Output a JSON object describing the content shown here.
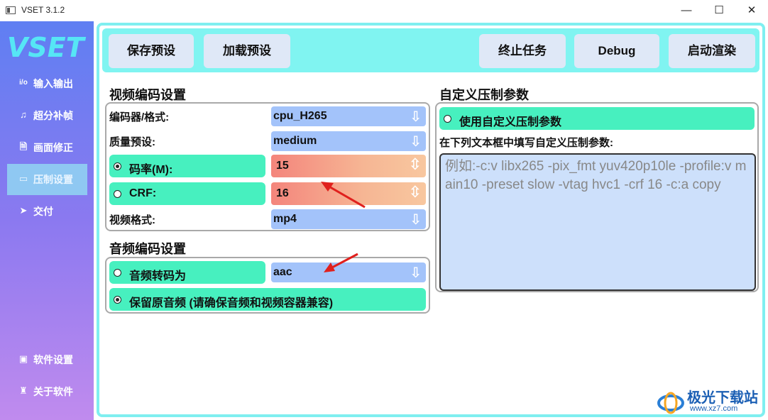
{
  "window": {
    "title": "VSET 3.1.2",
    "minimize_glyph": "—",
    "maximize_glyph": "☐",
    "close_glyph": "✕"
  },
  "sidebar": {
    "logo": "VSET",
    "items": [
      {
        "label": "输入输出",
        "icon": "io-icon",
        "glyph": "i/o"
      },
      {
        "label": "超分补帧",
        "icon": "bell-icon",
        "glyph": "♫"
      },
      {
        "label": "画面修正",
        "icon": "document-icon",
        "glyph": "🗎"
      },
      {
        "label": "压制设置",
        "icon": "monitor-icon",
        "glyph": "▭"
      },
      {
        "label": "交付",
        "icon": "send-icon",
        "glyph": "➤"
      }
    ],
    "bottom_items": [
      {
        "label": "软件设置",
        "icon": "settings-icon",
        "glyph": "▣"
      },
      {
        "label": "关于软件",
        "icon": "org-icon",
        "glyph": "♜"
      }
    ],
    "active_index": 3
  },
  "toolbar": {
    "save_preset": "保存预设",
    "load_preset": "加载预设",
    "stop_task": "终止任务",
    "debug": "Debug",
    "start_render": "启动渲染"
  },
  "video": {
    "section_title": "视频编码设置",
    "encoder_label": "编码器/格式:",
    "encoder_value": "cpu_H265",
    "preset_label": "质量预设:",
    "preset_value": "medium",
    "bitrate_label": "码率(M):",
    "bitrate_value": "15",
    "crf_label": "CRF:",
    "crf_value": "16",
    "format_label": "视频格式:",
    "format_value": "mp4",
    "bitrate_selected": true,
    "crf_selected": false
  },
  "audio": {
    "section_title": "音频编码设置",
    "transcode_label": "音频转码为",
    "transcode_value": "aac",
    "keep_label": "保留原音频 (请确保音频和视频容器兼容)",
    "transcode_selected": false,
    "keep_selected": true
  },
  "custom": {
    "section_title": "自定义压制参数",
    "use_custom_label": "使用自定义压制参数",
    "use_custom_selected": false,
    "hint": "在下列文本框中填写自定义压制参数:",
    "placeholder": "例如:-c:v libx265 -pix_fmt yuv420p10le -profile:v  main10 -preset slow -vtag hvc1 -crf 16 -c:a copy"
  },
  "watermark": {
    "brand": "极光下载站",
    "url": "www.xz7.com"
  },
  "colors": {
    "accent_cyan": "#80f4f1",
    "green_pill": "#47f0bf",
    "select_blue": "#a3c3fa",
    "arrow_red": "#e0201d"
  }
}
